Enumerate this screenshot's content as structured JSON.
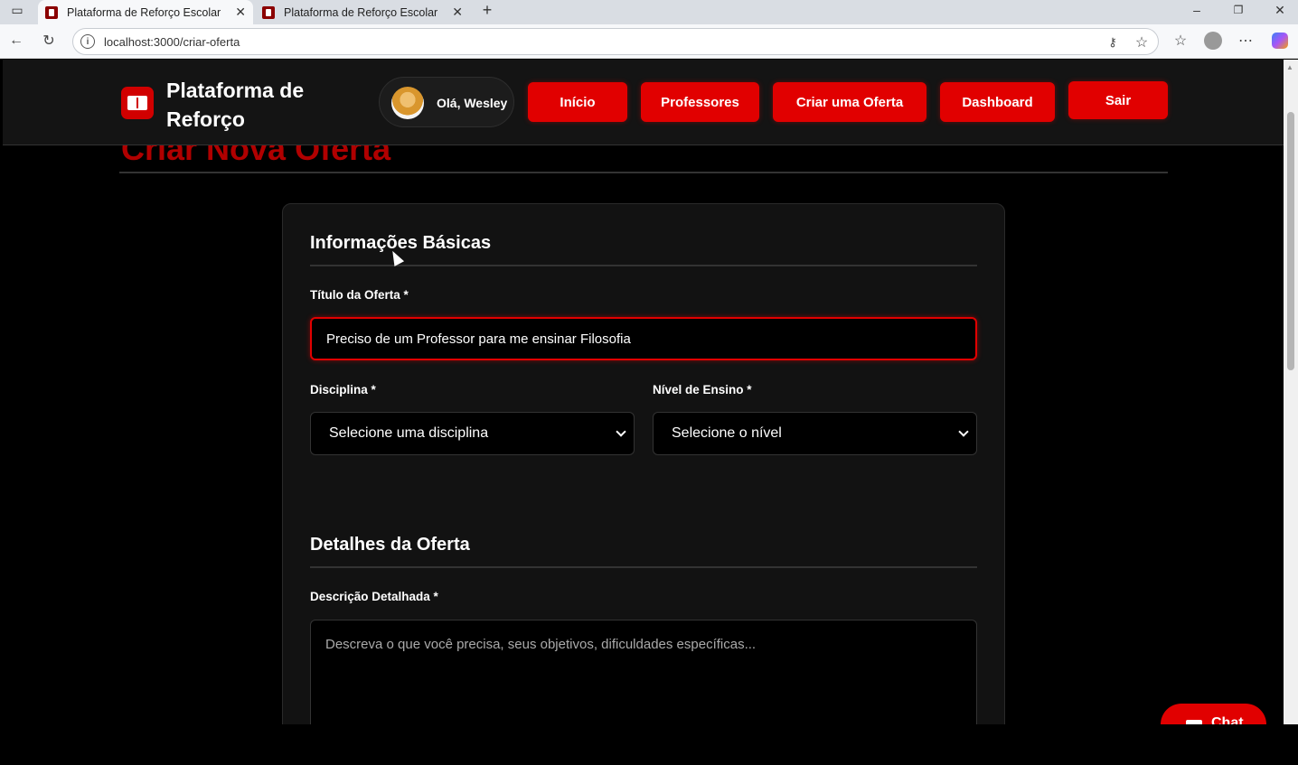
{
  "browser": {
    "tabs": [
      {
        "title": "Plataforma de Reforço Escolar",
        "active": true
      },
      {
        "title": "Plataforma de Reforço Escolar",
        "active": false
      }
    ],
    "new_tab_icon": "plus-icon",
    "url": "localhost:3000/criar-oferta"
  },
  "header": {
    "site_title": "Plataforma de Reforço",
    "greeting": "Olá, Wesley",
    "nav": {
      "inicio": "Início",
      "professores": "Professores",
      "criar_oferta": "Criar uma Oferta",
      "dashboard": "Dashboard",
      "sair": "Sair"
    },
    "accent_color": "#e10000"
  },
  "page": {
    "heading": "Criar Nova Oferta"
  },
  "form": {
    "section_basic": "Informações Básicas",
    "titulo_label": "Título da Oferta *",
    "titulo_value": "Preciso de um Professor para me ensinar Filosofia",
    "disciplina_label": "Disciplina *",
    "disciplina_value": "Selecione uma disciplina",
    "nivel_label": "Nível de Ensino *",
    "nivel_value": "Selecione o nível",
    "section_details": "Detalhes da Oferta",
    "descricao_label": "Descrição Detalhada *",
    "descricao_placeholder": "Descreva o que você precisa, seus objetivos, dificuldades específicas..."
  },
  "chat": {
    "label": "Chat"
  }
}
